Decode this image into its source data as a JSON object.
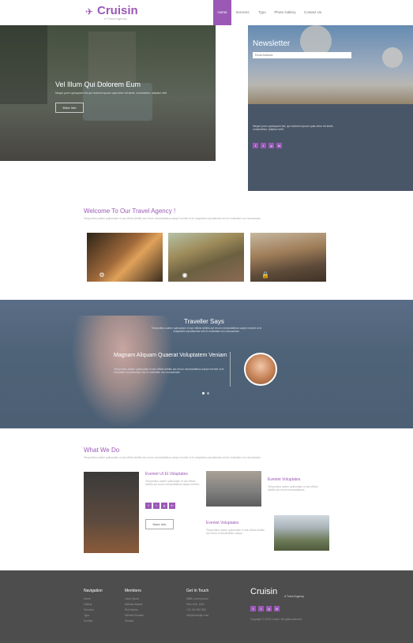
{
  "header": {
    "logo": "Cruisin",
    "logo_tagline": "A Travel Agency",
    "nav": [
      "Home",
      "Services",
      "Typo",
      "Photo Gallery",
      "Contact Us"
    ],
    "active_nav": "Home",
    "accent_color": "#9b59b6"
  },
  "hero": {
    "title": "Vel Illum Qui Dolorem Eum",
    "text": "Neque porro quisquam est qui dolorem ipsum quia dolor sit amet, consectetur, adipisci velit",
    "button": "More Info"
  },
  "newsletter": {
    "title": "Newsletter",
    "placeholder": "Email Address",
    "text": "Neque porro quisquam est, qui dolorem ipsum quia dolor sit amet, consectetur, adipisci velit.",
    "social": [
      "f",
      "t",
      "g",
      "in"
    ]
  },
  "welcome": {
    "title": "Welcome To Our Travel Agency !",
    "text": "Temporibus autem quibusdam et aut officiis debitis aut rerum necessitatibus saepe eveniet ut et voluptates repudiandae sint et molestiae non recusandae.",
    "icons": [
      "gear-icon",
      "eye-icon",
      "lock-icon"
    ]
  },
  "testimonial": {
    "title": "Traveller Says",
    "subtitle": "Temporibus autem quibusdam et aut officiis debitis aut rerum necessitatibus saepe eveniet ut et voluptates repudiandae sint et molestiae non recusandae.",
    "quote_title": "Magnam Aliquam Quaerat Voluptatem Veniam",
    "quote_text": "Temporibus autem quibusdam et aut officiis debitis aut rerum necessitatibus saepe eveniet ut et voluptates repudiandae sint et molestiae non recusandae.",
    "slides": 2,
    "active_slide": 1
  },
  "what_we_do": {
    "title": "What We Do",
    "text": "Temporibus autem quibusdam et aut officiis debitis aut rerum necessitatibus saepe eveniet ut et voluptates repudiandae sint et molestiae non recusandae.",
    "main": {
      "title": "Eveniet Ut Et Voluptates",
      "text": "Temporibus autem quibusdam et aut officiis debitis aut rerum necessitatibus saepe eveniet.",
      "button": "More Info"
    },
    "item2": {
      "title": "Eveniet Voluptates",
      "text": "Temporibus autem quibusdam et aut officiis debitis aut rerum necessitatibus."
    },
    "item3": {
      "title": "Eveniet Voluptates",
      "text": "Temporibus autem quibusdam et aut officiis debitis aut rerum necessitatibus saepe."
    }
  },
  "footer": {
    "navigation": {
      "title": "Navigation",
      "items": [
        "Home",
        "Gallery",
        "Services",
        "Typo",
        "Contact"
      ]
    },
    "members": {
      "title": "Members",
      "items": [
        "Laura Spoid",
        "Melissa Stapire",
        "Rick Barton",
        "Michael Sowden",
        "Sansup"
      ]
    },
    "contact": {
      "title": "Get In Touch",
      "items": [
        "8088 Lorem Ipsum",
        "New York, USA",
        "+01 234 567 890",
        "info@example.com"
      ]
    },
    "brand": {
      "logo": "Cruisin",
      "tagline": "A Travel Agency",
      "copyright": "Copyright © 2016 Cruisin. All rights reserved.",
      "social": [
        "f",
        "t",
        "g",
        "in"
      ]
    }
  }
}
